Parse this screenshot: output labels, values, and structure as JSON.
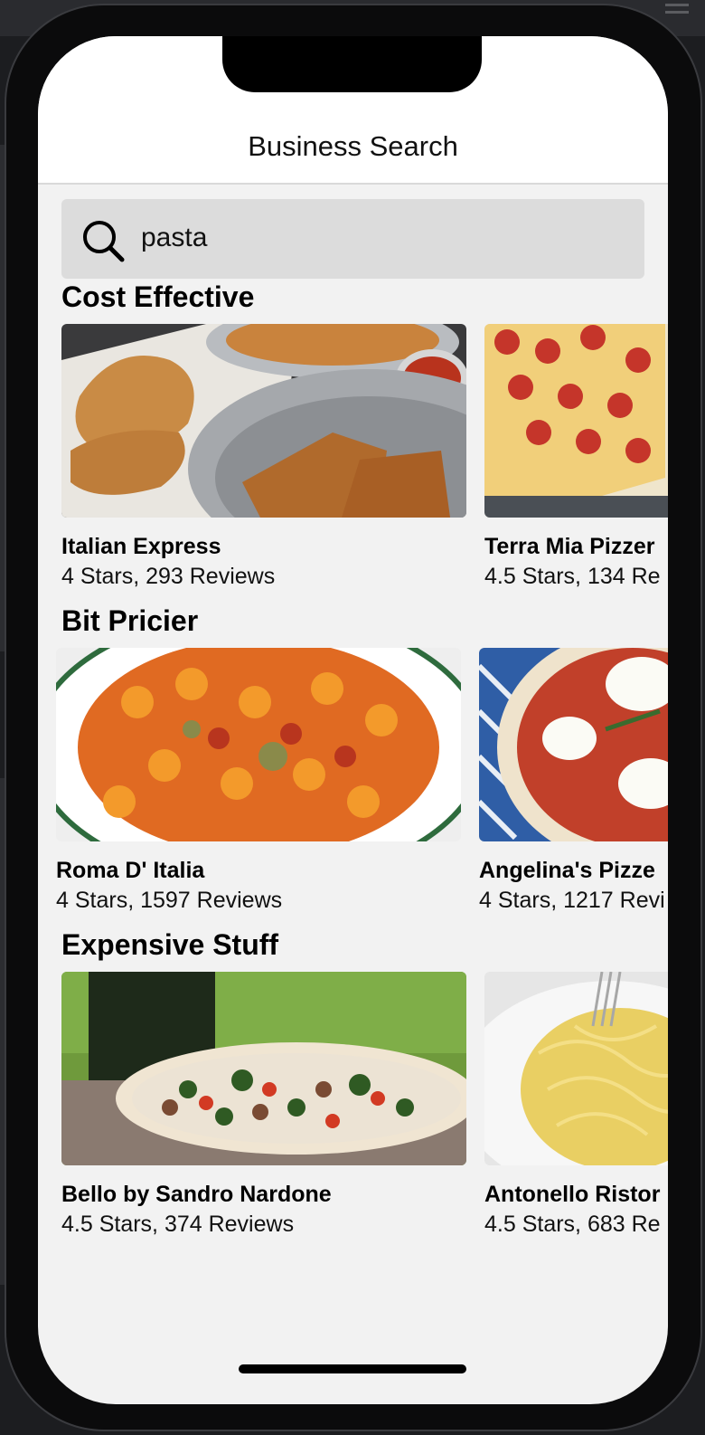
{
  "app": {
    "title": "Business Search"
  },
  "search": {
    "value": "pasta",
    "icon": "search-icon"
  },
  "sections": [
    {
      "title": "Cost Effective",
      "items": [
        {
          "name": "Italian Express",
          "meta": "4 Stars, 293 Reviews",
          "image": "food-photo-bread-fried"
        },
        {
          "name": "Terra Mia Pizzer",
          "meta": "4.5 Stars, 134 Re",
          "image": "food-photo-pepperoni-pizza"
        }
      ]
    },
    {
      "title": "Bit Pricier",
      "items": [
        {
          "name": "Roma D' Italia",
          "meta": "4 Stars, 1597 Reviews",
          "image": "food-photo-cavatappi-pasta"
        },
        {
          "name": "Angelina's Pizze",
          "meta": "4 Stars, 1217 Revi",
          "image": "food-photo-margherita-pizza"
        }
      ]
    },
    {
      "title": "Expensive Stuff",
      "items": [
        {
          "name": "Bello by Sandro Nardone",
          "meta": "4.5 Stars, 374 Reviews",
          "image": "food-photo-broccoli-rabe-pizza"
        },
        {
          "name": "Antonello Ristor",
          "meta": "4.5 Stars, 683 Re",
          "image": "food-photo-spaghetti"
        }
      ]
    }
  ],
  "colors": {
    "background": "#f2f2f2",
    "search_field": "#dcdcdc",
    "navbar": "#ffffff"
  }
}
